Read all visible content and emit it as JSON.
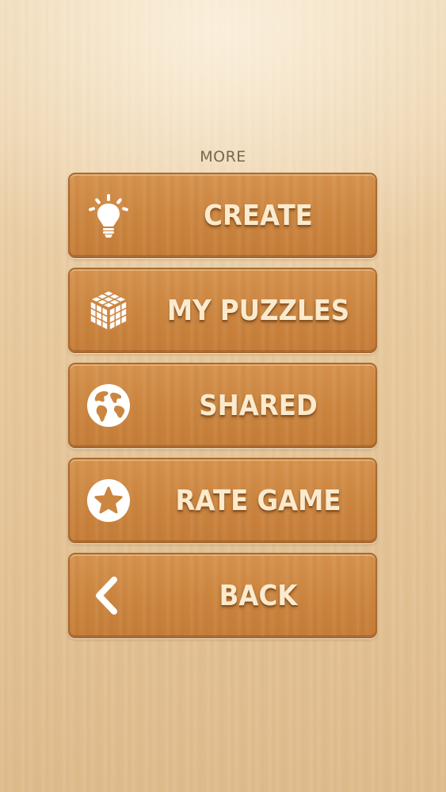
{
  "menu": {
    "heading": "MORE",
    "items": [
      {
        "label": "CREATE",
        "icon": "lightbulb-icon"
      },
      {
        "label": "MY PUZZLES",
        "icon": "cube-puzzle-icon"
      },
      {
        "label": "SHARED",
        "icon": "globe-icon"
      },
      {
        "label": "RATE GAME",
        "icon": "star-icon"
      },
      {
        "label": "BACK",
        "icon": "chevron-left-icon"
      }
    ]
  },
  "colors": {
    "background": "#e9cca2",
    "button": "#cc8640",
    "label": "#fbeacd",
    "icon": "#ffffff",
    "heading": "#7a6650"
  }
}
